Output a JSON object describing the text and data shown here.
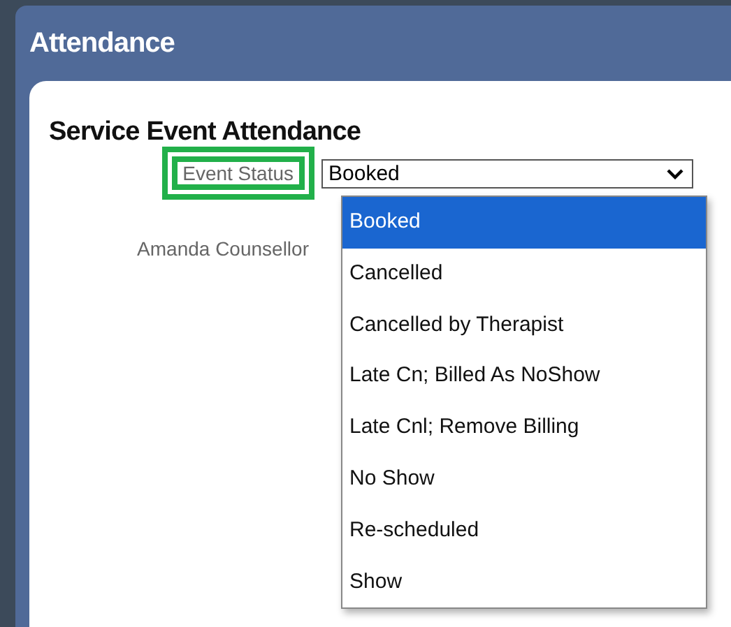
{
  "window": {
    "title": "Attendance"
  },
  "form": {
    "heading": "Service Event Attendance",
    "fields": [
      {
        "label": "Event Status",
        "value": "Booked",
        "highlighted": true
      },
      {
        "label": "Amanda Counsellor"
      }
    ]
  },
  "dropdown": {
    "options": [
      {
        "label": "Booked",
        "selected": true
      },
      {
        "label": "Cancelled",
        "selected": false
      },
      {
        "label": "Cancelled by Therapist",
        "selected": false
      },
      {
        "label": "Late Cn; Billed As NoShow",
        "selected": false
      },
      {
        "label": "Late Cnl; Remove Billing",
        "selected": false
      },
      {
        "label": "No Show",
        "selected": false
      },
      {
        "label": "Re-scheduled",
        "selected": false
      },
      {
        "label": "Show",
        "selected": false
      }
    ]
  }
}
